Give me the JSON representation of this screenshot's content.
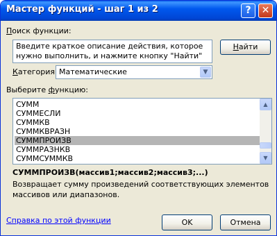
{
  "window": {
    "title": "Мастер функций - шаг 1 из 2",
    "help_glyph": "?",
    "close_glyph": "✕"
  },
  "search": {
    "label_underlined": "П",
    "label_rest": "оиск функции:",
    "description": "Введите краткое описание действия, которое нужно выполнить, и нажмите кнопку \"Найти\"",
    "find_underlined": "Н",
    "find_rest": "айти"
  },
  "category": {
    "label_underlined": "К",
    "label_rest": "атегория:",
    "value": "Математические"
  },
  "functions": {
    "label_before": "Выберите ",
    "label_underlined": "ф",
    "label_rest": "ункцию:",
    "items": [
      "СУММ",
      "СУММЕСЛИ",
      "СУММКВ",
      "СУММКВРАЗН",
      "СУММПРОИЗВ",
      "СУММРАЗНКВ",
      "СУММСУММКВ"
    ],
    "selected_index": 4
  },
  "selected_function": {
    "signature": "СУММПРОИЗВ(массив1;массив2;массив3;...)",
    "description": "Возвращает сумму произведений соответствующих элементов массивов или диапазонов."
  },
  "footer": {
    "help_link": "Справка по этой функции",
    "ok": "OK",
    "cancel": "Отмена"
  }
}
